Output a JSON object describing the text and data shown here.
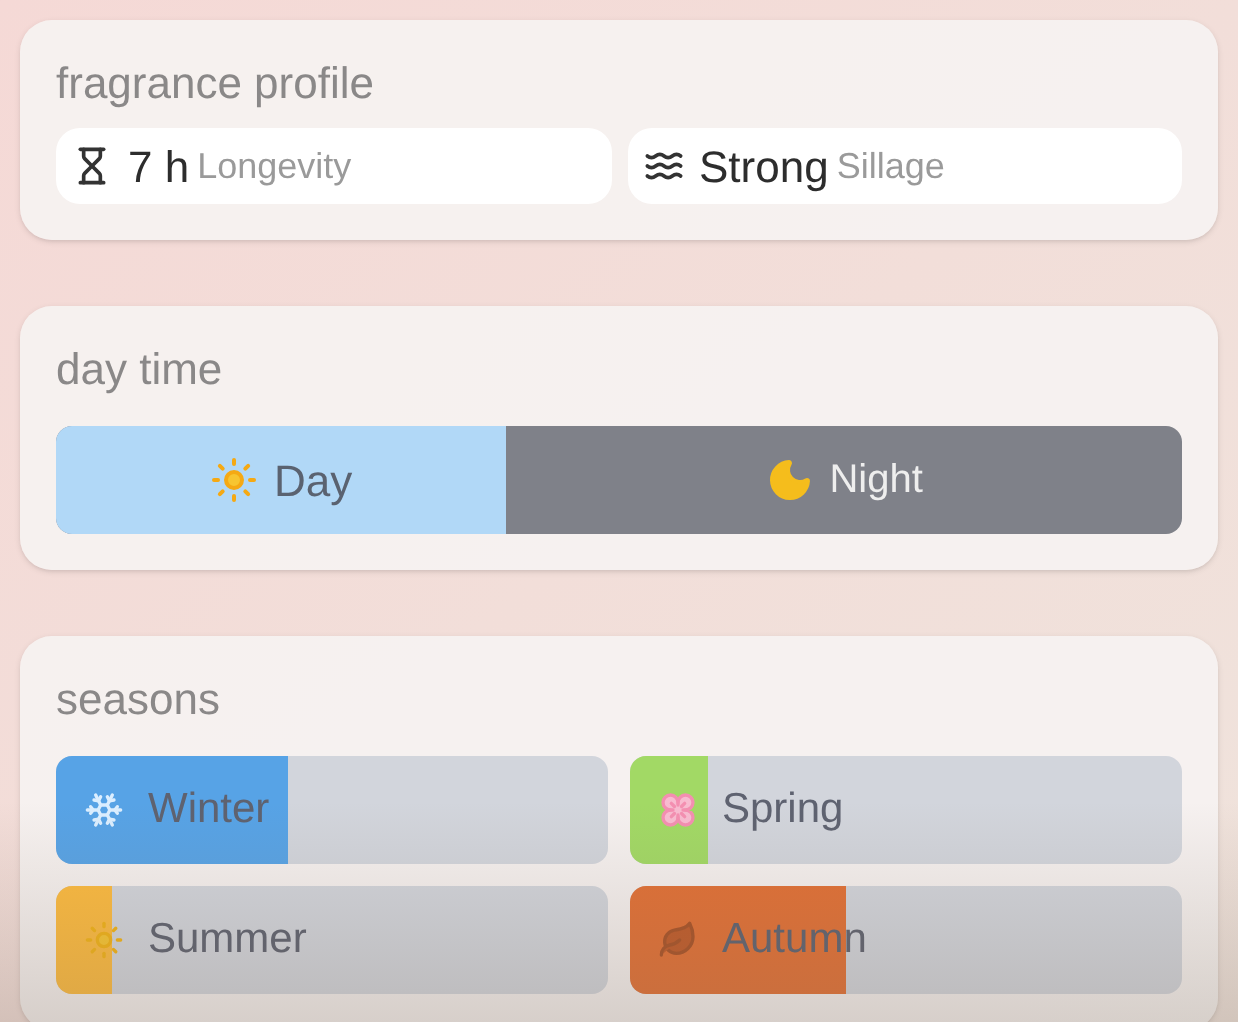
{
  "profile": {
    "title": "fragrance profile",
    "stats": [
      {
        "value": "7 h",
        "label": "Longevity"
      },
      {
        "value": "Strong",
        "label": "Sillage"
      }
    ]
  },
  "day_time": {
    "title": "day time",
    "level": 0.4,
    "segments": [
      {
        "label": "Day"
      },
      {
        "label": "Night"
      }
    ]
  },
  "seasons": {
    "title": "seasons",
    "items": [
      {
        "label": "Winter",
        "level": 0.42,
        "color": "#57a3e6"
      },
      {
        "label": "Spring",
        "level": 0.14,
        "color": "#a2d965"
      },
      {
        "label": "Summer",
        "level": 0.1,
        "color": "#fdbb3f"
      },
      {
        "label": "Autumn",
        "level": 0.39,
        "color": "#e27035"
      }
    ]
  }
}
